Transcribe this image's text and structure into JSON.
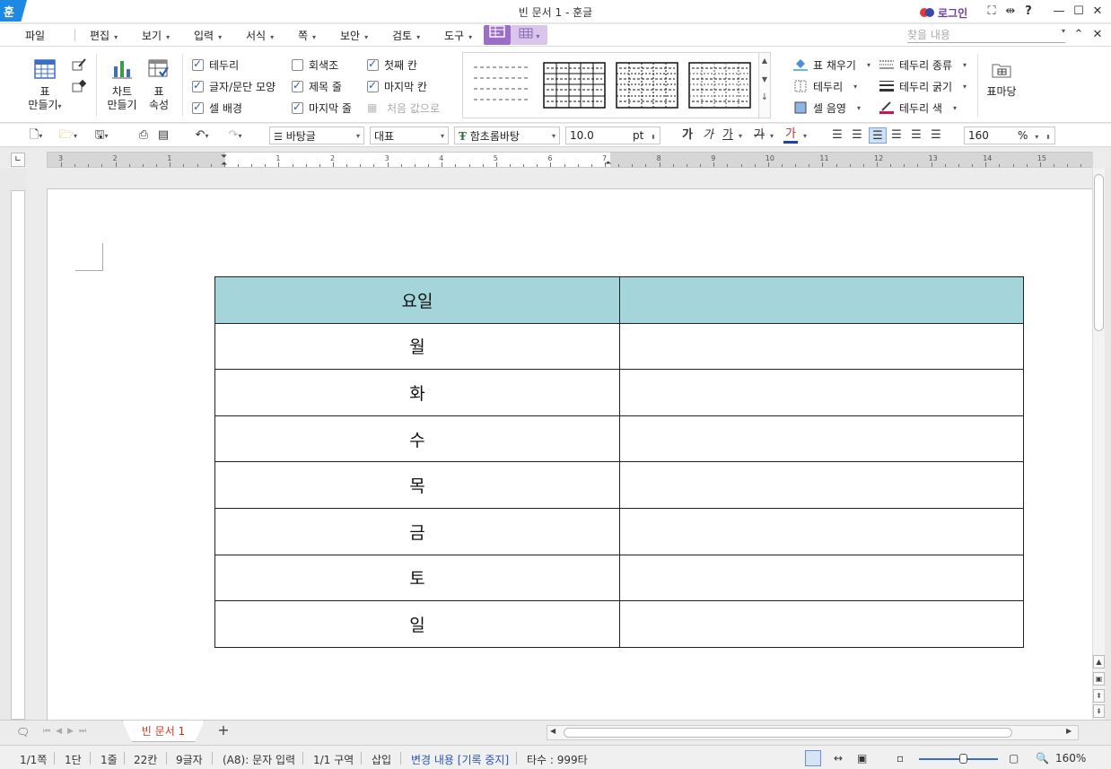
{
  "title_bar": {
    "app_logo": "훈",
    "title": "빈 문서 1 - 훈글",
    "login": "로그인",
    "help": "?"
  },
  "menu": {
    "file": "파일",
    "items": [
      {
        "label": "편집"
      },
      {
        "label": "보기"
      },
      {
        "label": "입력"
      },
      {
        "label": "서식"
      },
      {
        "label": "쪽"
      },
      {
        "label": "보안"
      },
      {
        "label": "검토"
      },
      {
        "label": "도구"
      }
    ],
    "search_placeholder": "찾을 내용"
  },
  "ribbon": {
    "table_make": {
      "line1": "표",
      "line2": "만들기"
    },
    "chart_make": {
      "line1": "차트",
      "line2": "만들기"
    },
    "table_props": {
      "line1": "표",
      "line2": "속성"
    },
    "checkboxes": [
      {
        "label": "테두리",
        "checked": true
      },
      {
        "label": "글자/문단 모양",
        "checked": true
      },
      {
        "label": "셀 배경",
        "checked": true
      },
      {
        "label": "회색조",
        "checked": false
      },
      {
        "label": "제목 줄",
        "checked": true
      },
      {
        "label": "마지막 줄",
        "checked": true
      },
      {
        "label": "첫째 칸",
        "checked": true
      },
      {
        "label": "마지막 칸",
        "checked": true
      },
      {
        "label": "처음 값으로",
        "checked": false,
        "disabled": true
      }
    ],
    "right_items": [
      {
        "label": "표 채우기",
        "icon": "fill-bucket-icon"
      },
      {
        "label": "테두리",
        "icon": "border-icon"
      },
      {
        "label": "셀 음영",
        "icon": "cell-shade-icon"
      },
      {
        "label": "테두리 종류",
        "icon": "border-type-icon"
      },
      {
        "label": "테두리 굵기",
        "icon": "border-weight-icon"
      },
      {
        "label": "테두리 색",
        "icon": "border-color-icon"
      }
    ],
    "table_margin": "표마당"
  },
  "toolbar": {
    "style": "바탕글",
    "lang": "대표",
    "font": "함초롬바탕",
    "font_size": "10.0",
    "size_unit": "pt",
    "bold": "가",
    "italic": "가",
    "underline": "가",
    "strike": "가",
    "color_char": "가",
    "zoom": "160",
    "zoom_unit": "%"
  },
  "ruler": {
    "labels": [
      "3",
      "2",
      "1",
      "",
      "1",
      "2",
      "3",
      "4",
      "5",
      "6",
      "7",
      "8",
      "9",
      "10",
      "11",
      "12",
      "13",
      "14",
      "15"
    ]
  },
  "table": {
    "header": [
      "요일",
      ""
    ],
    "rows": [
      [
        "월",
        ""
      ],
      [
        "화",
        ""
      ],
      [
        "수",
        ""
      ],
      [
        "목",
        ""
      ],
      [
        "금",
        ""
      ],
      [
        "토",
        ""
      ],
      [
        "일",
        ""
      ]
    ],
    "header_color": "#a4d5da"
  },
  "tabs": {
    "doc_tab": "빈 문서 1",
    "add": "+"
  },
  "status": {
    "page": "1/1쪽",
    "column": "1단",
    "line": "1줄",
    "col": "22칸",
    "chars": "9글자",
    "cell_mode": "(A8): 문자 입력",
    "section": "1/1 구역",
    "insert": "삽입",
    "track": "변경 내용 [기록 중지]",
    "typing": "타수 : 999타",
    "zoom": "160%"
  },
  "colors": {
    "accent": "#9d6ec8",
    "logo": "#1e88e5",
    "track_text": "#2a56b8"
  }
}
